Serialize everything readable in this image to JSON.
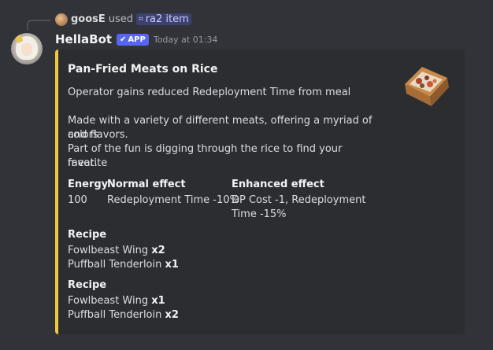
{
  "reply": {
    "user": "goosE",
    "used_text": "used",
    "command": "ra2 item"
  },
  "message": {
    "author": "HellaBot",
    "app_tag": "APP",
    "timestamp": "Today at 01:34"
  },
  "embed": {
    "accent_color": "#f0c93a",
    "title": "Pan-Fried Meats on Rice",
    "subtitle": "Operator gains reduced Redeployment Time from meal",
    "description_line1": "Made with a variety of different meats, offering a myriad of colors",
    "description_line2": "and flavors.",
    "description_line3": "Part of the fun is digging through the rice to find your favorite",
    "description_line4": "meat.",
    "fields": {
      "energy_name": "Energy",
      "energy_value": "100",
      "normal_name": "Normal effect",
      "normal_value": "Redeployment Time -10%",
      "enhanced_name": "Enhanced effect",
      "enhanced_value_line1": "DP Cost -1, Redeployment",
      "enhanced_value_line2": "Time -15%"
    },
    "recipes": [
      {
        "name": "Recipe",
        "items": [
          {
            "item": "Fowlbeast Wing ",
            "qty": "x2"
          },
          {
            "item": "Puffball Tenderloin ",
            "qty": "x1"
          }
        ]
      },
      {
        "name": "Recipe",
        "items": [
          {
            "item": "Fowlbeast Wing ",
            "qty": "x1"
          },
          {
            "item": "Puffball Tenderloin ",
            "qty": "x2"
          }
        ]
      }
    ]
  }
}
